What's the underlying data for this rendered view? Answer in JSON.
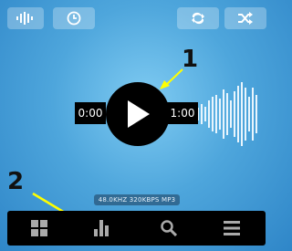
{
  "player": {
    "current_time": "0:00",
    "total_time": "1:00",
    "audio_info": "48.0KHZ 320KBPS MP3"
  },
  "top_bar": {
    "left_buttons": [
      "equalizer-icon",
      "clock-icon"
    ],
    "right_buttons": [
      "repeat-icon",
      "shuffle-icon"
    ]
  },
  "bottom_nav": {
    "items": [
      "grid-icon",
      "bar-chart-icon",
      "search-icon",
      "menu-icon"
    ]
  },
  "annotations": {
    "callout_1": "1",
    "callout_2": "2"
  },
  "colors": {
    "background": "#4ea6dc",
    "annotation_arrow": "#ffff00",
    "bar": "#000000"
  }
}
